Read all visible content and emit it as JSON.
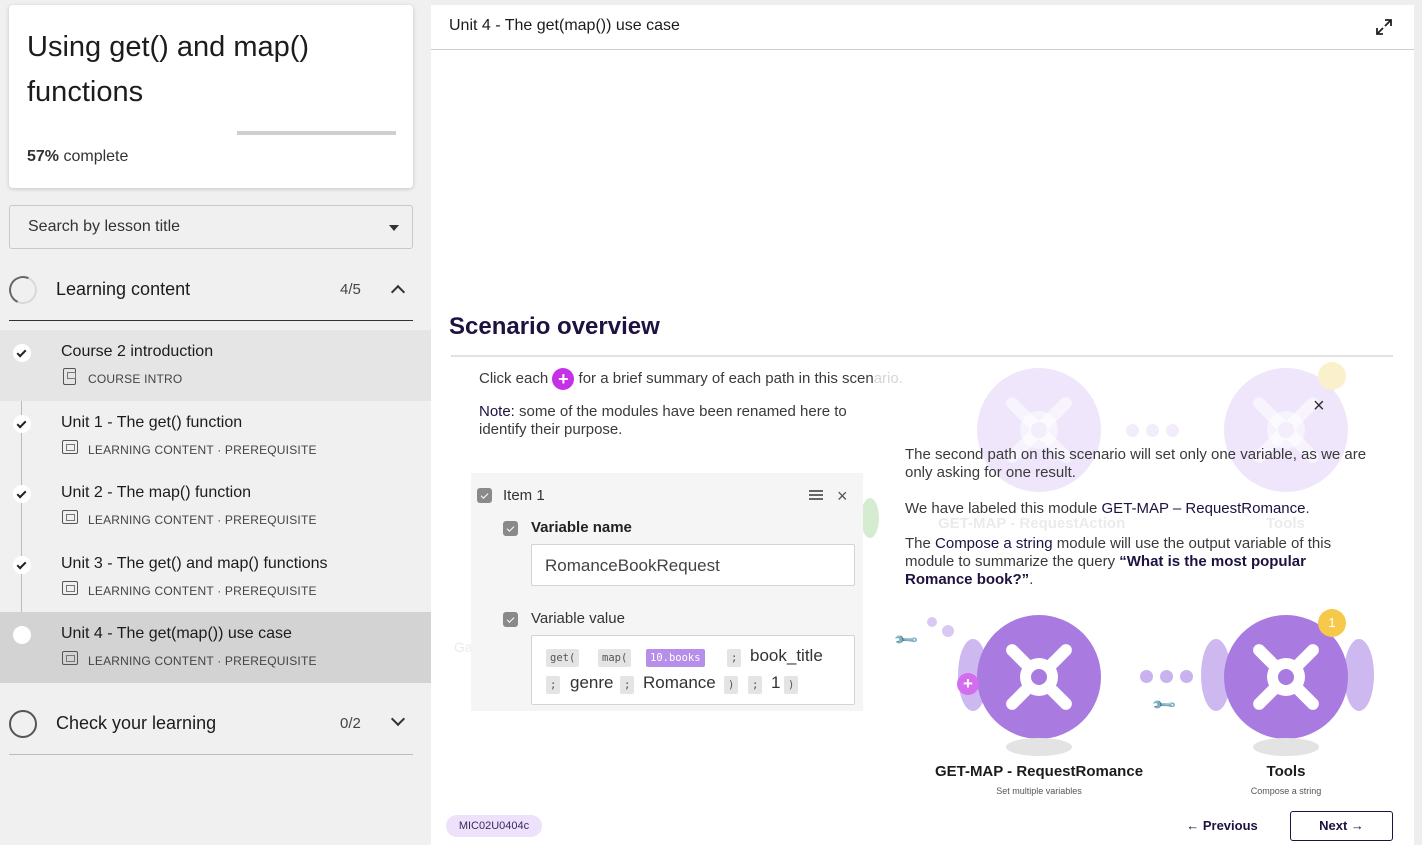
{
  "course": {
    "title": "Using get() and map() functions",
    "progress_percent": "57%",
    "progress_suffix": " complete",
    "progress_fraction": 0.57
  },
  "search": {
    "label": "Search by lesson title"
  },
  "sections": [
    {
      "title": "Learning content",
      "count": "4/5",
      "expanded": true
    },
    {
      "title": "Check your learning",
      "count": "0/2",
      "expanded": false
    }
  ],
  "lessons": [
    {
      "title": "Course 2 introduction",
      "meta": "COURSE INTRO",
      "done": true
    },
    {
      "title": "Unit 1 - The get() function",
      "meta": "LEARNING CONTENT · PREREQUISITE",
      "done": true
    },
    {
      "title": "Unit 2 - The map() function",
      "meta": "LEARNING CONTENT · PREREQUISITE",
      "done": true
    },
    {
      "title": "Unit 3 - The get() and map() functions",
      "meta": "LEARNING CONTENT · PREREQUISITE",
      "done": true
    },
    {
      "title": "Unit 4 - The get(map()) use case",
      "meta": "LEARNING CONTENT · PREREQUISITE",
      "done": false,
      "active": true
    }
  ],
  "main": {
    "unit_title": "Unit 4 - The get(map()) use case",
    "scenario_title": "Scenario overview",
    "click_prefix": "Click each",
    "click_plus": "+",
    "click_suffix": "for a brief summary of each path in this scen",
    "click_faded": "ario.",
    "note_label": "Note:",
    "note_text": " some of the modules have been renamed here to identify their purpose."
  },
  "mapping": {
    "item_label": "Item 1",
    "var_name_label": "Variable name",
    "var_name_value": "RomanceBookRequest",
    "var_value_label": "Variable value",
    "tokens": {
      "get": "get(",
      "map": "map(",
      "books": "10.books",
      "sep1": ";",
      "book_title": "book_title",
      "sep2": ";",
      "genre": "genre",
      "sep3": ";",
      "romance": "Romance",
      "close1": ")",
      "sep4": ";",
      "one": "1",
      "close2": ")"
    }
  },
  "popover": {
    "p1": "The second path on this scenario will set only one variable, as we are only asking for one result.",
    "p2_prefix": "We have labeled this module ",
    "p2_bold": "GET-MAP – RequestRomance",
    "p2_suffix": ".",
    "p3_prefix": "The ",
    "p3_bold": "Compose a string",
    "p3_mid": " module will use the output variable of this module to summarize the query ",
    "p3_quote": "“What is the most popular Romance book?”",
    "p3_suffix": ".",
    "close": "×"
  },
  "scenario": {
    "module1_name": "GET-MAP - RequestRomance",
    "module1_sub": "Set multiple variables",
    "module2_name": "Tools",
    "module2_sub": "Compose a string",
    "badge": "1",
    "ghost1_name": "GET-MAP - RequestAction",
    "ghost2_name": "Tools",
    "ghost_left": "Ga"
  },
  "footer": {
    "code": "MIC02U0404c",
    "prev": "← Previous",
    "next": "Next →"
  },
  "colors": {
    "accent_purple": "#a97be0",
    "plus_magenta": "#c531e6",
    "title_navy": "#1f1140",
    "badge_yellow": "#f7c94a"
  }
}
